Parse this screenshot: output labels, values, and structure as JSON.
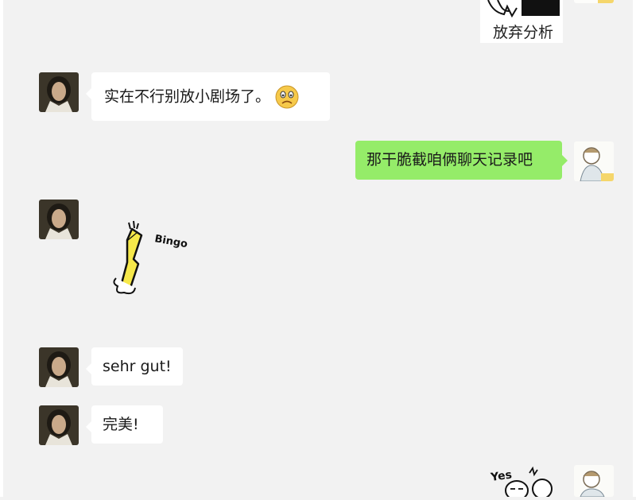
{
  "colors": {
    "background": "#f2f2f2",
    "received_bubble": "#ffffff",
    "sent_bubble": "#95ec69"
  },
  "top_sticker": {
    "caption": "放弃分析"
  },
  "messages": [
    {
      "side": "left",
      "text": "实在不行别放小剧场了。",
      "emoji": "frowning-face"
    },
    {
      "side": "right",
      "text": "那干脆截咱俩聊天记录吧"
    },
    {
      "side": "left",
      "sticker": "bingo-finger-sticker",
      "sticker_text": "Bingo"
    },
    {
      "side": "left",
      "text": "sehr gut!"
    },
    {
      "side": "left",
      "text": "完美!"
    },
    {
      "side": "right",
      "sticker": "yes-sticker",
      "sticker_text": "Yes"
    }
  ]
}
